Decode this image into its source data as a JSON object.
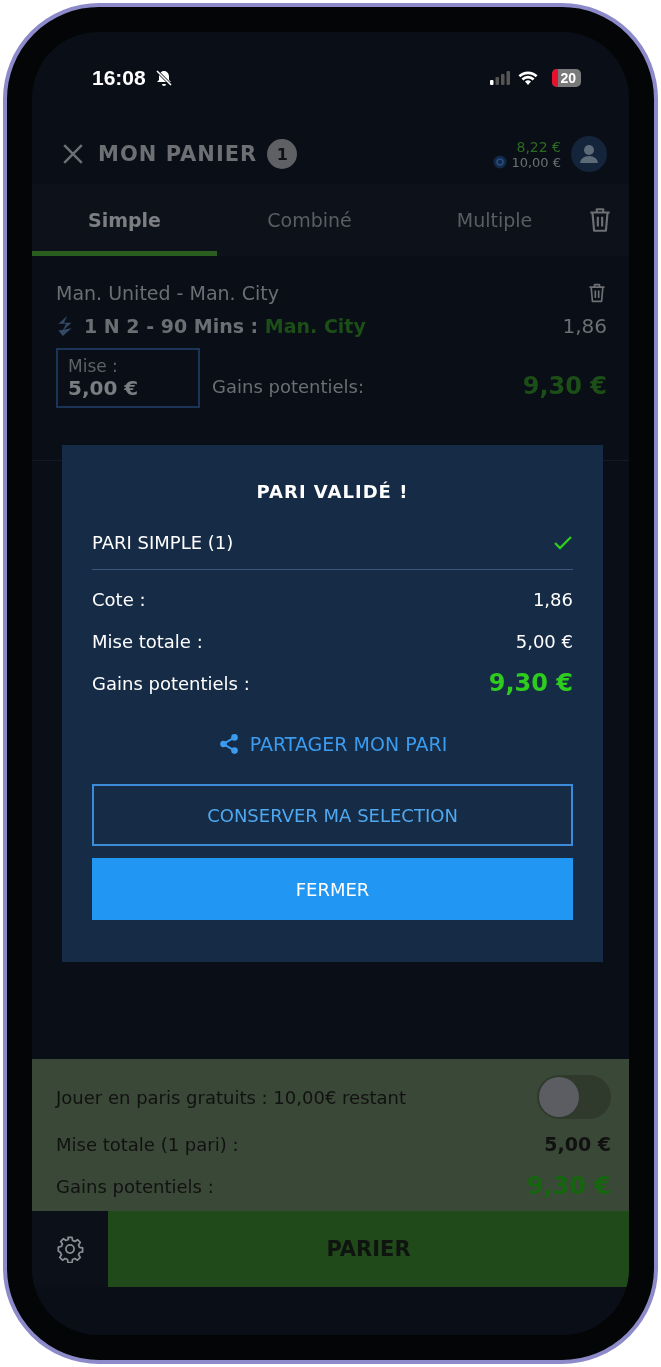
{
  "status_bar": {
    "time": "16:08",
    "battery": "20"
  },
  "header": {
    "title": "MON PANIER",
    "count": "1",
    "balance": "8,22 €",
    "bonus": "10,00 €"
  },
  "tabs": [
    {
      "label": "Simple",
      "selected": true
    },
    {
      "label": "Combiné",
      "selected": false
    },
    {
      "label": "Multiple",
      "selected": false
    }
  ],
  "bet": {
    "match": "Man. United - Man. City",
    "market": "1 N 2 - 90 Mins :",
    "selection": "Man. City",
    "odds": "1,86",
    "stake_label": "Mise :",
    "stake": "5,00 €",
    "gains_label": "Gains potentiels:",
    "gains": "9,30 €"
  },
  "modal": {
    "title": "PARI VALIDÉ !",
    "bet_type": "PARI SIMPLE (1)",
    "confirmed": true,
    "rows": [
      {
        "label": "Cote :",
        "value": "1,86",
        "kind": "plain"
      },
      {
        "label": "Mise totale :",
        "value": "5,00 €",
        "kind": "plain"
      },
      {
        "label": "Gains potentiels :",
        "value": "9,30 €",
        "kind": "highlight"
      }
    ],
    "share": "PARTAGER MON PARI",
    "buttons": [
      {
        "label": "CONSERVER MA SELECTION",
        "kind": "outline"
      },
      {
        "label": "FERMER",
        "kind": "primary"
      }
    ]
  },
  "footer": {
    "freebet": {
      "label": "Jouer en paris gratuits : 10,00€ restant",
      "on": false
    },
    "rows": [
      {
        "label": "Mise totale (1 pari) :",
        "value": "5,00 €",
        "kind": "plain"
      },
      {
        "label": "Gains potentiels :",
        "value": "9,30 €",
        "kind": "highlight"
      }
    ],
    "button": "PARIER"
  }
}
